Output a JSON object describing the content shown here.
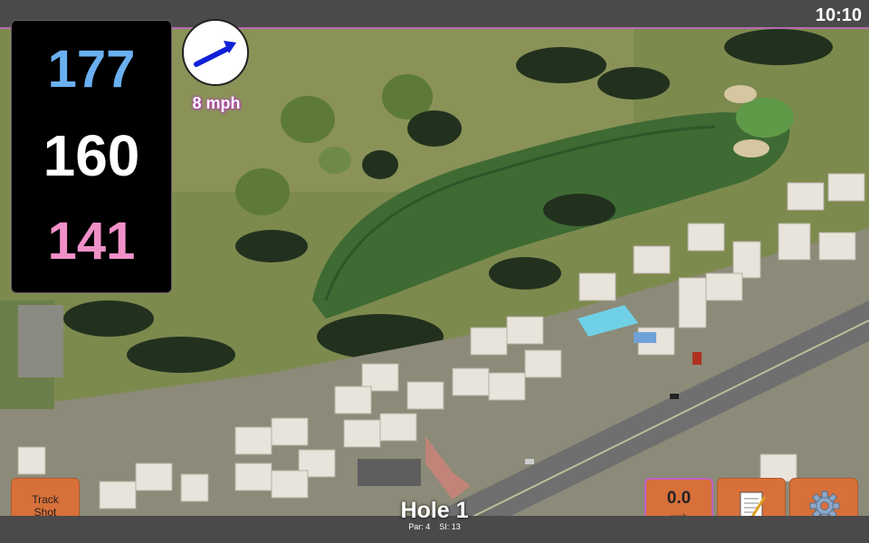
{
  "status": {
    "time": "10:10"
  },
  "distances": {
    "back": "177",
    "middle": "160",
    "front": "141"
  },
  "wind": {
    "speed": "8 mph",
    "direction_icon": "arrow-right-icon",
    "arrow_color": "#1020d8"
  },
  "buttons": {
    "track_shot_line1": "Track",
    "track_shot_line2": "Shot",
    "speed_value": "0.0",
    "speed_unit": "mph",
    "notes_icon": "notepad-icon",
    "settings_icon": "gear-icon"
  },
  "hole": {
    "title": "Hole 1",
    "par_label": "Par: 4",
    "si_label": "SI: 13"
  },
  "colors": {
    "back": "#6ab0f0",
    "middle": "#ffffff",
    "front": "#f090c8",
    "button": "#d8703a",
    "accent": "#b66bb0"
  }
}
